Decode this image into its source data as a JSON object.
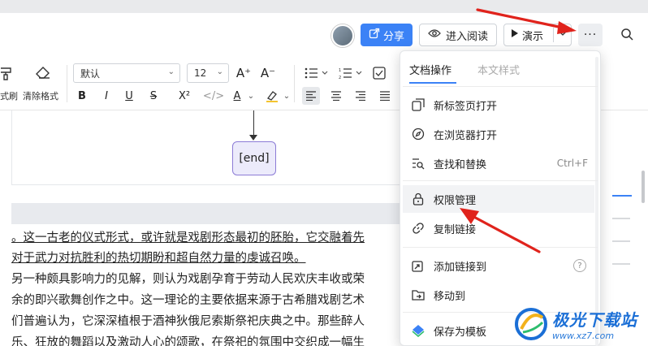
{
  "header": {
    "share_label": "分享",
    "read_label": "进入阅读",
    "present_label": "演示",
    "more_label": "···"
  },
  "toolbar": {
    "format_brush_label": "式刷",
    "clear_format_label": "清除格式",
    "font_family_value": "默认",
    "font_size_value": "12",
    "bold": "B",
    "italic": "I",
    "underline": "U",
    "strike": "S",
    "superscript": "X²",
    "code": "</>",
    "font_color": "A",
    "highlight": "A",
    "font_grow": "A⁺",
    "font_shrink": "A⁻"
  },
  "document": {
    "end_node_label": "[end]",
    "paragraphs": [
      "。这一古老的仪式形式，或许就是戏剧形态最初的胚胎，它交融着先",
      "对于武力对抗胜利的热切期盼和超自然力量的虔诚召唤。",
      "另一种颇具影响力的见解，则认为戏剧孕育于劳动人民欢庆丰收或荣",
      "余的即兴歌舞创作之中。这一理论的主要依据来源于古希腊戏剧艺术",
      "们普遍认为，它深深植根于酒神狄俄尼索斯祭祀庆典之中。那些醉人",
      "乐、狂放的舞蹈以及激动人心的颂歌，在祭祀的氛围中交织成一幅生"
    ]
  },
  "menu": {
    "tabs": [
      {
        "label": "文档操作",
        "active": true
      },
      {
        "label": "本文样式",
        "active": false
      }
    ],
    "items": [
      {
        "label": "新标签页打开",
        "icon": "open-new-tab-icon",
        "shortcut": ""
      },
      {
        "label": "在浏览器打开",
        "icon": "compass-icon",
        "shortcut": ""
      },
      {
        "label": "查找和替换",
        "icon": "find-replace-icon",
        "shortcut": "Ctrl+F"
      },
      {
        "label": "权限管理",
        "icon": "lock-icon",
        "shortcut": ""
      },
      {
        "label": "复制链接",
        "icon": "link-icon",
        "shortcut": ""
      },
      {
        "label": "添加链接到",
        "icon": "add-link-icon",
        "shortcut": "?"
      },
      {
        "label": "移动到",
        "icon": "folder-move-icon",
        "shortcut": ""
      },
      {
        "label": "保存为模板",
        "icon": "template-icon",
        "shortcut": ""
      }
    ]
  },
  "watermark": {
    "title": "极光下载站",
    "url": "www.xz7.com"
  },
  "colors": {
    "accent": "#3b82f6",
    "annotation_arrow": "#e0231c",
    "end_node_border": "#8c7cd6",
    "end_node_fill": "#ecebfb"
  }
}
